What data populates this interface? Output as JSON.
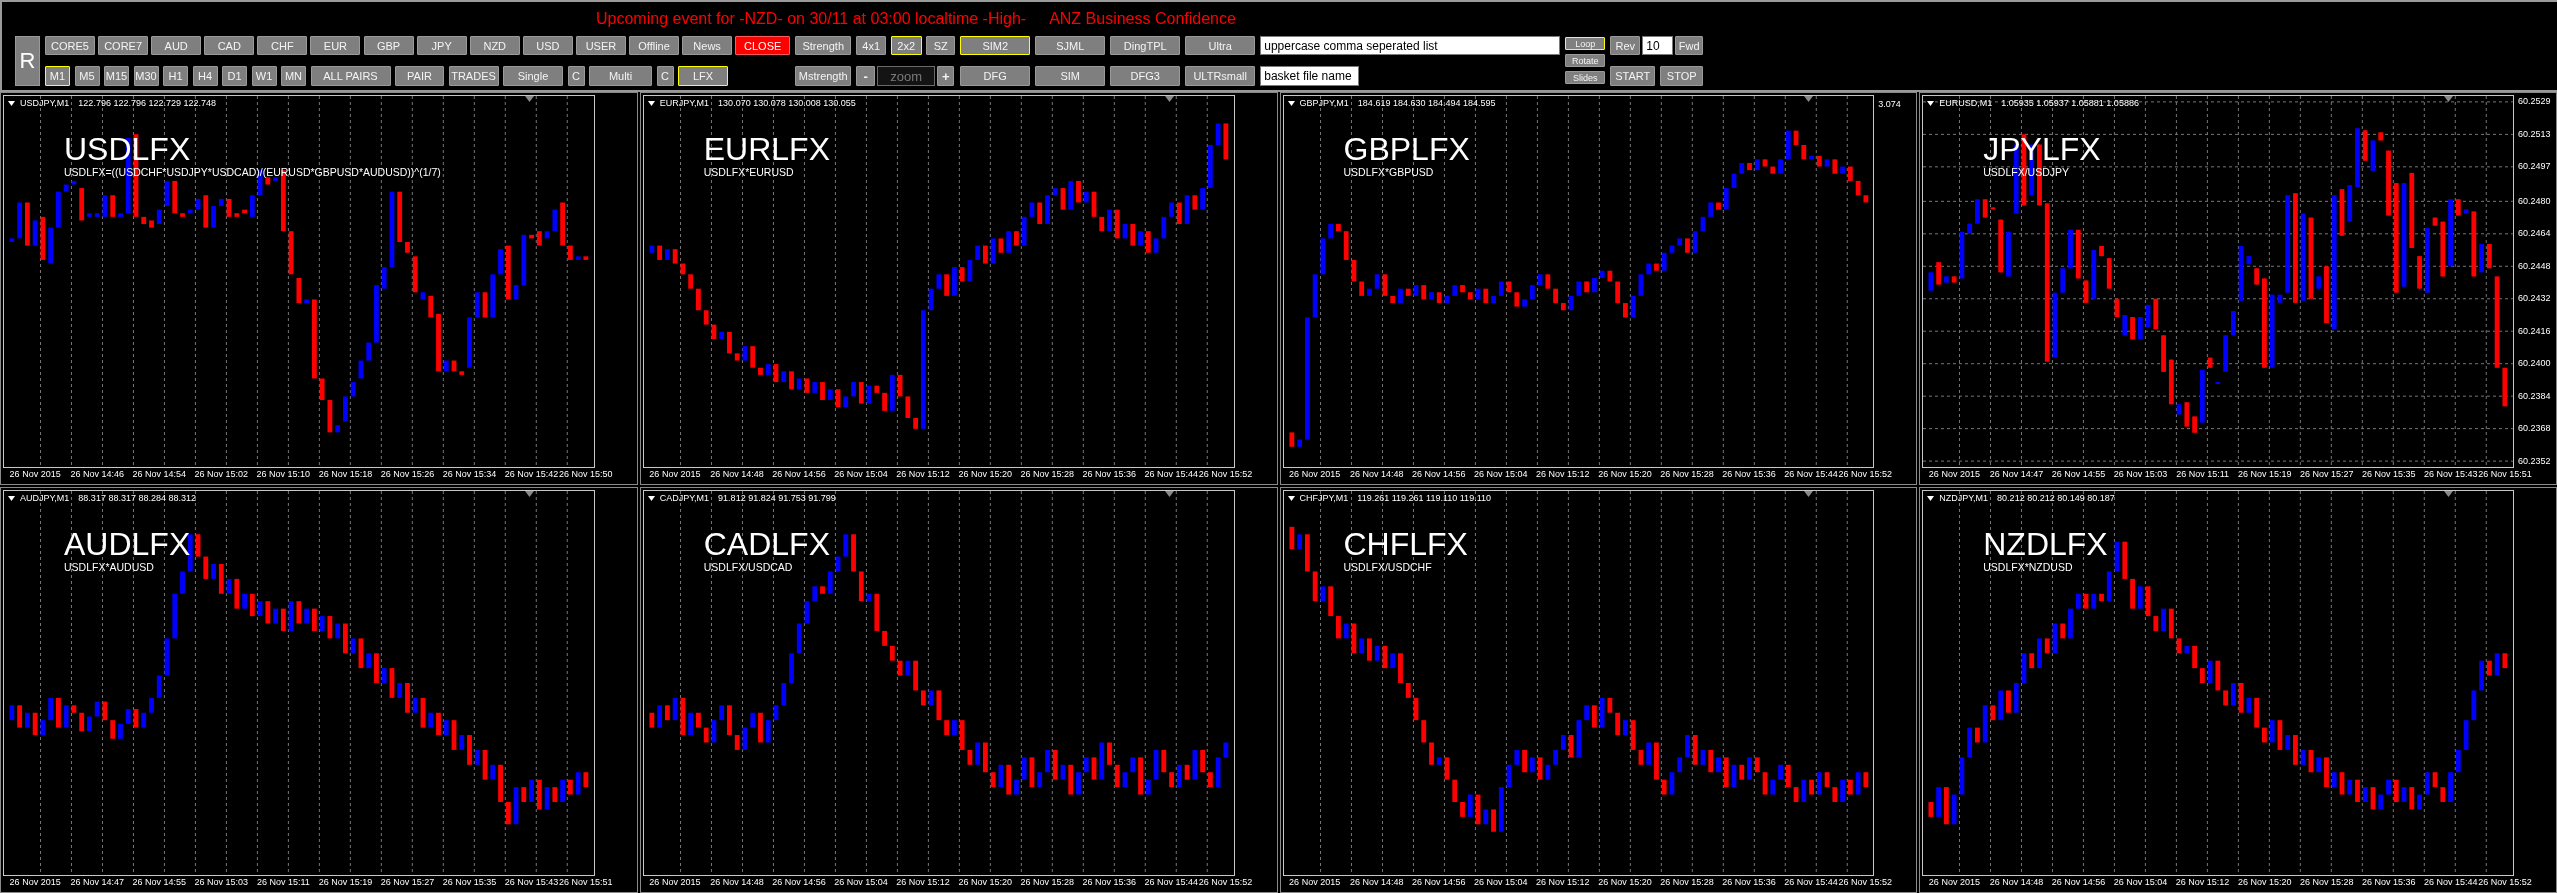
{
  "event_alert": {
    "message": "Upcoming event for -NZD- on 30/11 at 03:00 localtime -High-",
    "event": "ANZ Business Confidence"
  },
  "toolbar": {
    "reset_button": {
      "label": "R"
    },
    "sections": [
      {
        "rows": [
          {
            "items": [
              {
                "kind": "button",
                "label": "CORE5",
                "selected": false
              },
              {
                "kind": "button",
                "label": "CORE7",
                "selected": false
              },
              {
                "kind": "button",
                "label": "AUD",
                "selected": false
              },
              {
                "kind": "button",
                "label": "CAD",
                "selected": false
              },
              {
                "kind": "button",
                "label": "CHF",
                "selected": false
              },
              {
                "kind": "button",
                "label": "EUR",
                "selected": false
              },
              {
                "kind": "button",
                "label": "GBP",
                "selected": false
              },
              {
                "kind": "button",
                "label": "JPY",
                "selected": false
              },
              {
                "kind": "button",
                "label": "NZD",
                "selected": false
              },
              {
                "kind": "button",
                "label": "USD",
                "selected": false
              },
              {
                "kind": "button",
                "label": "USER",
                "selected": false
              },
              {
                "kind": "button",
                "label": "Offline",
                "selected": false
              },
              {
                "kind": "button",
                "label": "News",
                "selected": false
              },
              {
                "kind": "alert",
                "label": "CLOSE",
                "selected": false
              }
            ]
          },
          {
            "items": [
              {
                "kind": "button",
                "label": "M1",
                "selected": true
              },
              {
                "kind": "button",
                "label": "M5",
                "selected": false
              },
              {
                "kind": "button",
                "label": "M15",
                "selected": false
              },
              {
                "kind": "button",
                "label": "M30",
                "selected": false
              },
              {
                "kind": "button",
                "label": "H1",
                "selected": false
              },
              {
                "kind": "button",
                "label": "H4",
                "selected": false
              },
              {
                "kind": "button",
                "label": "D1",
                "selected": false
              },
              {
                "kind": "button",
                "label": "W1",
                "selected": false
              },
              {
                "kind": "button",
                "label": "MN",
                "selected": false
              },
              {
                "kind": "button",
                "label": "ALL PAIRS",
                "selected": false
              },
              {
                "kind": "button",
                "label": "PAIR",
                "selected": false
              },
              {
                "kind": "button",
                "label": "TRADES",
                "selected": false
              },
              {
                "kind": "button",
                "label": "Single",
                "selected": false
              },
              {
                "kind": "button",
                "label": "C",
                "selected": false
              },
              {
                "kind": "button",
                "label": "Multi",
                "selected": false
              },
              {
                "kind": "button",
                "label": "C",
                "selected": false
              },
              {
                "kind": "button",
                "label": "LFX",
                "selected": true
              }
            ]
          }
        ]
      },
      {
        "rows": [
          {
            "items": [
              {
                "kind": "button",
                "label": "Strength",
                "selected": false
              }
            ]
          },
          {
            "items": [
              {
                "kind": "button",
                "label": "Mstrength",
                "selected": false
              }
            ]
          }
        ]
      },
      {
        "rows": [
          {
            "items": [
              {
                "kind": "button",
                "label": "4x1",
                "selected": false
              },
              {
                "kind": "button",
                "label": "2x2",
                "selected": true
              },
              {
                "kind": "button",
                "label": "SZ",
                "selected": false
              }
            ]
          },
          {
            "items": [
              {
                "kind": "step",
                "label": "-",
                "selected": false
              },
              {
                "kind": "spin-field",
                "placeholder": "zoom"
              },
              {
                "kind": "step",
                "label": "+",
                "selected": false
              }
            ]
          }
        ]
      },
      {
        "rows": [
          {
            "items": [
              {
                "kind": "button",
                "label": "SIM2",
                "selected": true
              },
              {
                "kind": "button",
                "label": "SJML",
                "selected": false
              },
              {
                "kind": "button",
                "label": "DingTPL",
                "selected": false
              },
              {
                "kind": "button",
                "label": "Ultra",
                "selected": false
              }
            ]
          },
          {
            "items": [
              {
                "kind": "button",
                "label": "DFG",
                "selected": false
              },
              {
                "kind": "button",
                "label": "SIM",
                "selected": false
              },
              {
                "kind": "button",
                "label": "DFG3",
                "selected": false
              },
              {
                "kind": "button",
                "label": "ULTRsmall",
                "selected": false
              }
            ]
          }
        ]
      },
      {
        "rows": [
          {
            "items": [
              {
                "kind": "field",
                "value": "uppercase comma seperated list"
              }
            ]
          },
          {
            "items": [
              {
                "kind": "field",
                "value": "basket file name"
              }
            ]
          }
        ]
      },
      {
        "rows": [
          {
            "items": [
              {
                "kind": "mini",
                "label": "Loop",
                "selected": true
              }
            ]
          },
          {
            "items": [
              {
                "kind": "mini",
                "label": "Rotate",
                "selected": false
              }
            ]
          },
          {
            "items": [
              {
                "kind": "mini",
                "label": "Slides",
                "selected": false
              }
            ]
          }
        ]
      },
      {
        "rows": [
          {
            "items": [
              {
                "kind": "button",
                "label": "Rev",
                "selected": false
              },
              {
                "kind": "field",
                "value": "10"
              },
              {
                "kind": "button",
                "label": "Fwd",
                "selected": false
              }
            ]
          },
          {
            "items": [
              {
                "kind": "button",
                "label": "START",
                "selected": false
              },
              {
                "kind": "button",
                "label": "STOP",
                "selected": false
              }
            ]
          }
        ]
      }
    ]
  },
  "charts": [
    {
      "symbol": "USDJPY,M1",
      "quote": "122.796 122.796 122.729 122.748",
      "title": "USDLFX",
      "formula": "USDLFX=((USDCHF*USDJPY*USDCAD)/(EURUSD*GBPUSD*AUDUSD))^(1/7)",
      "time_labels": [
        "26 Nov 2015",
        "26 Nov 14:46",
        "26 Nov 14:54",
        "26 Nov 15:02",
        "26 Nov 15:10",
        "26 Nov 15:18",
        "26 Nov 15:26",
        "26 Nov 15:34",
        "26 Nov 15:42",
        "26 Nov 15:50"
      ]
    },
    {
      "symbol": "EURJPY,M1",
      "quote": "130.070 130.078 130.008 130.055",
      "title": "EURLFX",
      "formula": "USDLFX*EURUSD",
      "time_labels": [
        "26 Nov 2015",
        "26 Nov 14:48",
        "26 Nov 14:56",
        "26 Nov 15:04",
        "26 Nov 15:12",
        "26 Nov 15:20",
        "26 Nov 15:28",
        "26 Nov 15:36",
        "26 Nov 15:44",
        "26 Nov 15:52"
      ]
    },
    {
      "symbol": "GBPJPY,M1",
      "quote": "184.619 184.630 184.494 184.595",
      "title": "GBPLFX",
      "formula": "USDLFX*GBPUSD",
      "price_marker": "3.074",
      "time_labels": [
        "26 Nov 2015",
        "26 Nov 14:48",
        "26 Nov 14:56",
        "26 Nov 15:04",
        "26 Nov 15:12",
        "26 Nov 15:20",
        "26 Nov 15:28",
        "26 Nov 15:36",
        "26 Nov 15:44",
        "26 Nov 15:52"
      ]
    },
    {
      "symbol": "EURUSD,M1",
      "quote": "1.05935 1.05937 1.05881 1.05886",
      "title": "JPYLFX",
      "formula": "USDLFX/USDJPY",
      "chart_data": {
        "type": "candlestick",
        "grid": true,
        "ylim": [
          60.2352,
          60.2529
        ],
        "categories": [
          null,
          null,
          null,
          "26 Nov 2015",
          null,
          null,
          null,
          null,
          null,
          null,
          null,
          "26 Nov 14:47",
          null,
          null,
          null,
          null,
          null,
          null,
          null,
          "26 Nov 14:55",
          null,
          null,
          null,
          null,
          null,
          null,
          null,
          "26 Nov 15:03",
          null,
          null,
          null,
          null,
          null,
          null,
          null,
          "26 Nov 15:11",
          null,
          null,
          null,
          null,
          null,
          null,
          null,
          "26 Nov 15:19",
          null,
          null,
          null,
          null,
          null,
          null,
          null,
          "26 Nov 15:27",
          null,
          null,
          null,
          null,
          null,
          null,
          null,
          "26 Nov 15:35",
          null,
          null,
          null,
          null,
          null,
          null,
          null,
          "26 Nov 15:43",
          null,
          null,
          null,
          null,
          null,
          null,
          "26 Nov 15:51"
        ],
        "yticks": [
          {
            "value": 60.2529,
            "label": "60.2529"
          },
          {
            "value": 60.2513,
            "label": "60.2513"
          },
          {
            "value": 60.2497,
            "label": "60.2497"
          },
          {
            "value": 60.248,
            "label": "60.2480"
          },
          {
            "value": 60.2464,
            "label": "60.2464"
          },
          {
            "value": 60.2448,
            "label": "60.2448"
          },
          {
            "value": 60.2432,
            "label": "60.2432"
          },
          {
            "value": 60.2416,
            "label": "60.2416"
          },
          {
            "value": 60.24,
            "label": "60.2400"
          },
          {
            "value": 60.2384,
            "label": "60.2384"
          },
          {
            "value": 60.2368,
            "label": "60.2368"
          },
          {
            "value": 60.2352,
            "label": "60.2352"
          }
        ],
        "ohlc": [
          [
            60.2436,
            60.2445,
            60.2436,
            60.2445
          ],
          [
            60.245,
            60.245,
            60.2439,
            60.2439
          ],
          [
            60.244,
            60.2443,
            60.244,
            60.2443
          ],
          [
            60.2443,
            60.2443,
            60.244,
            60.244
          ],
          [
            60.2442,
            60.2465,
            60.2442,
            60.2465
          ],
          [
            60.2464,
            60.2469,
            60.2464,
            60.2469
          ],
          [
            60.2469,
            60.2481,
            60.2469,
            60.2481
          ],
          [
            60.2481,
            60.2481,
            60.2472,
            60.2472
          ],
          [
            60.2477,
            60.2477,
            60.2476,
            60.2476
          ],
          [
            60.2471,
            60.2471,
            60.2445,
            60.2445
          ],
          [
            60.2443,
            60.2465,
            60.2443,
            60.2465
          ],
          [
            60.2474,
            60.2508,
            60.2474,
            60.2508
          ],
          [
            60.2513,
            60.2513,
            60.2478,
            60.2478
          ],
          [
            60.2483,
            60.2508,
            60.2483,
            60.2508
          ],
          [
            60.2508,
            60.2508,
            60.2478,
            60.2478
          ],
          [
            60.2479,
            60.2479,
            60.2401,
            60.2401
          ],
          [
            60.2403,
            60.2435,
            60.2403,
            60.2435
          ],
          [
            60.2435,
            60.2447,
            60.2435,
            60.2447
          ],
          [
            60.2447,
            60.2466,
            60.2447,
            60.2466
          ],
          [
            60.2466,
            60.2466,
            60.2442,
            60.2442
          ],
          [
            60.2441,
            60.2441,
            60.243,
            60.243
          ],
          [
            60.2432,
            60.2456,
            60.2432,
            60.2456
          ],
          [
            60.2458,
            60.2458,
            60.2453,
            60.2453
          ],
          [
            60.2452,
            60.2452,
            60.2437,
            60.2437
          ],
          [
            60.2432,
            60.2432,
            60.2423,
            60.2423
          ],
          [
            60.2414,
            60.2424,
            60.2414,
            60.2424
          ],
          [
            60.2423,
            60.2423,
            60.2412,
            60.2412
          ],
          [
            60.2412,
            60.2423,
            60.2412,
            60.2423
          ],
          [
            60.2418,
            60.2429,
            60.2418,
            60.2429
          ],
          [
            60.2432,
            60.2432,
            60.2417,
            60.2417
          ],
          [
            60.2414,
            60.2414,
            60.2396,
            60.2396
          ],
          [
            60.2402,
            60.2402,
            60.238,
            60.238
          ],
          [
            60.2375,
            60.238,
            60.2375,
            60.238
          ],
          [
            60.2381,
            60.2381,
            60.2369,
            60.2369
          ],
          [
            60.2374,
            60.2374,
            60.2366,
            60.2366
          ],
          [
            60.2371,
            60.2397,
            60.2371,
            60.2397
          ],
          [
            60.2403,
            60.2403,
            60.2398,
            60.2398
          ],
          [
            60.239,
            60.2391,
            60.239,
            60.2391
          ],
          [
            60.2396,
            60.2414,
            60.2396,
            60.2414
          ],
          [
            60.2414,
            60.2426,
            60.2414,
            60.2426
          ],
          [
            60.2431,
            60.2458,
            60.2431,
            60.2458
          ],
          [
            60.2449,
            60.2453,
            60.2449,
            60.2453
          ],
          [
            60.2447,
            60.2447,
            60.2439,
            60.2439
          ],
          [
            60.2442,
            60.2442,
            60.2398,
            60.2398
          ],
          [
            60.2398,
            60.2434,
            60.2398,
            60.2434
          ],
          [
            60.243,
            60.2434,
            60.243,
            60.2434
          ],
          [
            60.2435,
            60.2483,
            60.2435,
            60.2483
          ],
          [
            60.2484,
            60.2484,
            60.243,
            60.243
          ],
          [
            60.2431,
            60.2474,
            60.2431,
            60.2474
          ],
          [
            60.2472,
            60.2472,
            60.2432,
            60.2432
          ],
          [
            60.2437,
            60.2443,
            60.2437,
            60.2443
          ],
          [
            60.2448,
            60.2448,
            60.242,
            60.242
          ],
          [
            60.2417,
            60.2483,
            60.2417,
            60.2483
          ],
          [
            60.2486,
            60.2486,
            60.2463,
            60.2463
          ],
          [
            60.247,
            60.2488,
            60.247,
            60.2488
          ],
          [
            60.2487,
            60.2516,
            60.2487,
            60.2516
          ],
          [
            60.2515,
            60.2515,
            60.25,
            60.25
          ],
          [
            60.2495,
            60.251,
            60.2495,
            60.251
          ],
          [
            60.2514,
            60.2514,
            60.251,
            60.251
          ],
          [
            60.2505,
            60.2505,
            60.2473,
            60.2473
          ],
          [
            60.2489,
            60.2489,
            60.2435,
            60.2435
          ],
          [
            60.2438,
            60.2489,
            60.2438,
            60.2489
          ],
          [
            60.2494,
            60.2494,
            60.2457,
            60.2457
          ],
          [
            60.2453,
            60.2453,
            60.2437,
            60.2437
          ],
          [
            60.2435,
            60.2467,
            60.2435,
            60.2467
          ],
          [
            60.2472,
            60.2472,
            60.2468,
            60.2468
          ],
          [
            60.247,
            60.247,
            60.2443,
            60.2443
          ],
          [
            60.2448,
            60.2481,
            60.2448,
            60.2481
          ],
          [
            60.2481,
            60.2481,
            60.2473,
            60.2473
          ],
          [
            60.2474,
            60.2476,
            60.2474,
            60.2476
          ],
          [
            60.2475,
            60.2475,
            60.2443,
            60.2443
          ],
          [
            60.2445,
            60.2459,
            60.2445,
            60.2459
          ],
          [
            60.2459,
            60.2459,
            60.2447,
            60.2447
          ],
          [
            60.2443,
            60.2443,
            60.2398,
            60.2398
          ],
          [
            60.2398,
            60.2398,
            60.2379,
            60.2379
          ]
        ]
      }
    },
    {
      "symbol": "AUDJPY,M1",
      "quote": "88.317 88.317 88.284 88.312",
      "title": "AUDLFX",
      "formula": "USDLFX*AUDUSD",
      "time_labels": [
        "26 Nov 2015",
        "26 Nov 14:47",
        "26 Nov 14:55",
        "26 Nov 15:03",
        "26 Nov 15:11",
        "26 Nov 15:19",
        "26 Nov 15:27",
        "26 Nov 15:35",
        "26 Nov 15:43",
        "26 Nov 15:51"
      ]
    },
    {
      "symbol": "CADJPY,M1",
      "quote": "91.812 91.824 91.753 91.799",
      "title": "CADLFX",
      "formula": "USDLFX/USDCAD",
      "time_labels": [
        "26 Nov 2015",
        "26 Nov 14:48",
        "26 Nov 14:56",
        "26 Nov 15:04",
        "26 Nov 15:12",
        "26 Nov 15:20",
        "26 Nov 15:28",
        "26 Nov 15:36",
        "26 Nov 15:44",
        "26 Nov 15:52"
      ]
    },
    {
      "symbol": "CHFJPY,M1",
      "quote": "119.261 119.261 119.110 119.110",
      "title": "CHFLFX",
      "formula": "USDLFX/USDCHF",
      "time_labels": [
        "26 Nov 2015",
        "26 Nov 14:48",
        "26 Nov 14:56",
        "26 Nov 15:04",
        "26 Nov 15:12",
        "26 Nov 15:20",
        "26 Nov 15:28",
        "26 Nov 15:36",
        "26 Nov 15:44",
        "26 Nov 15:52"
      ]
    },
    {
      "symbol": "NZDJPY,M1",
      "quote": "80.212 80.212 80.149 80.187",
      "title": "NZDLFX",
      "formula": "USDLFX*NZDUSD",
      "time_labels": [
        "26 Nov 2015",
        "26 Nov 14:48",
        "26 Nov 14:56",
        "26 Nov 15:04",
        "26 Nov 15:12",
        "26 Nov 15:20",
        "26 Nov 15:28",
        "26 Nov 15:36",
        "26 Nov 15:44",
        "26 Nov 15:52"
      ]
    }
  ]
}
